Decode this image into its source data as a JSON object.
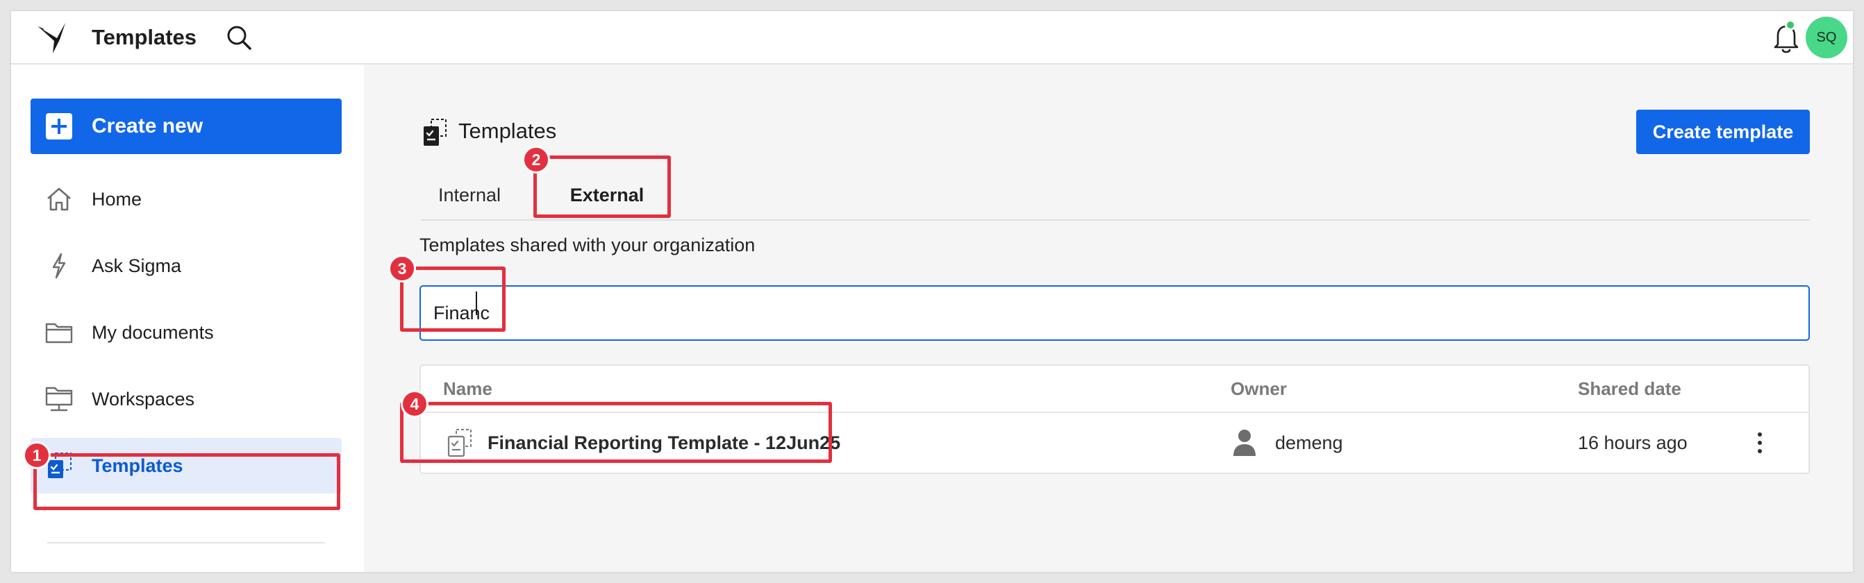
{
  "header": {
    "app_title": "Templates",
    "logo": "sigma-bird-logo",
    "search_icon": "search-icon",
    "notification_icon": "bell-icon",
    "notification_dot_color": "#37c46b",
    "avatar_initials": "SQ",
    "avatar_color": "#48d887"
  },
  "sidebar": {
    "create_new_label": "Create new",
    "items": [
      {
        "label": "Home",
        "icon": "home-icon",
        "active": false
      },
      {
        "label": "Ask Sigma",
        "icon": "lightning-icon",
        "active": false
      },
      {
        "label": "My documents",
        "icon": "folder-icon",
        "active": false
      },
      {
        "label": "Workspaces",
        "icon": "workspace-icon",
        "active": false
      },
      {
        "label": "Templates",
        "icon": "template-icon",
        "active": true
      }
    ]
  },
  "main": {
    "page_title": "Templates",
    "create_template_label": "Create template",
    "tabs": [
      {
        "label": "Internal",
        "active": false
      },
      {
        "label": "External",
        "active": true
      }
    ],
    "subtitle": "Templates shared with your organization",
    "search": {
      "value": "Financ"
    },
    "table": {
      "columns": [
        "Name",
        "Owner",
        "Shared date"
      ],
      "rows": [
        {
          "name": "Financial Reporting Template - 12Jun25",
          "owner": "demeng",
          "shared_date": "16 hours ago"
        }
      ]
    }
  },
  "annotations": {
    "badges": [
      "1",
      "2",
      "3",
      "4"
    ],
    "highlight_color": "#e3303f"
  },
  "colors": {
    "accent": "#1167e8",
    "active_nav_bg": "#e4ebfb",
    "main_bg": "#f5f5f5"
  }
}
